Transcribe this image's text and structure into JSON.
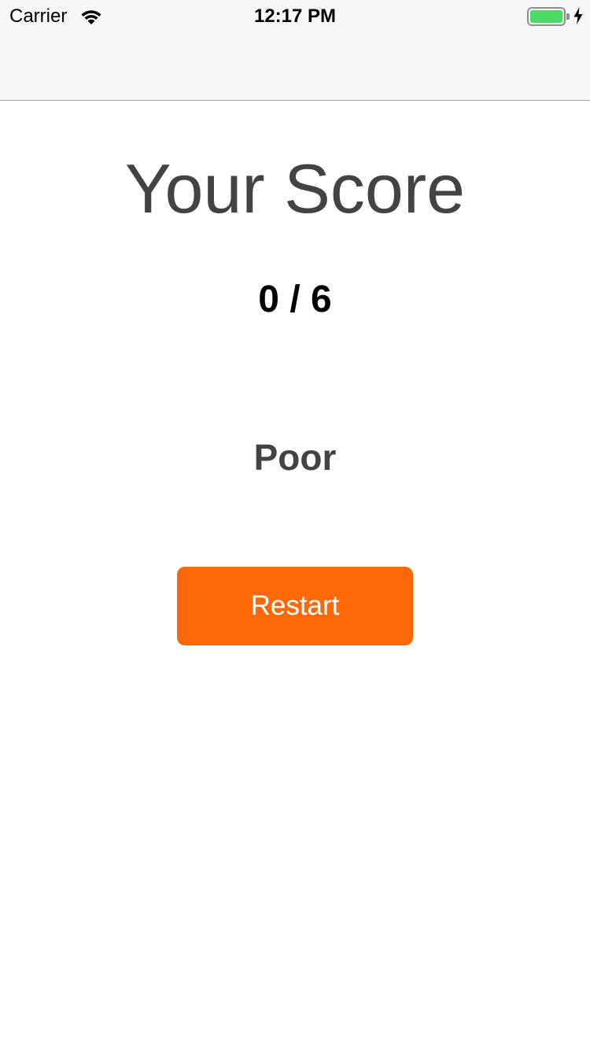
{
  "status_bar": {
    "carrier": "Carrier",
    "time": "12:17 PM",
    "icons": {
      "wifi": "wifi-icon",
      "battery": "battery-icon",
      "charging": "charging-bolt-icon"
    },
    "battery_color": "#4cd964"
  },
  "main": {
    "title": "Your Score",
    "score": "0 / 6",
    "rating": "Poor",
    "restart_label": "Restart",
    "accent_color": "#fd6909"
  }
}
